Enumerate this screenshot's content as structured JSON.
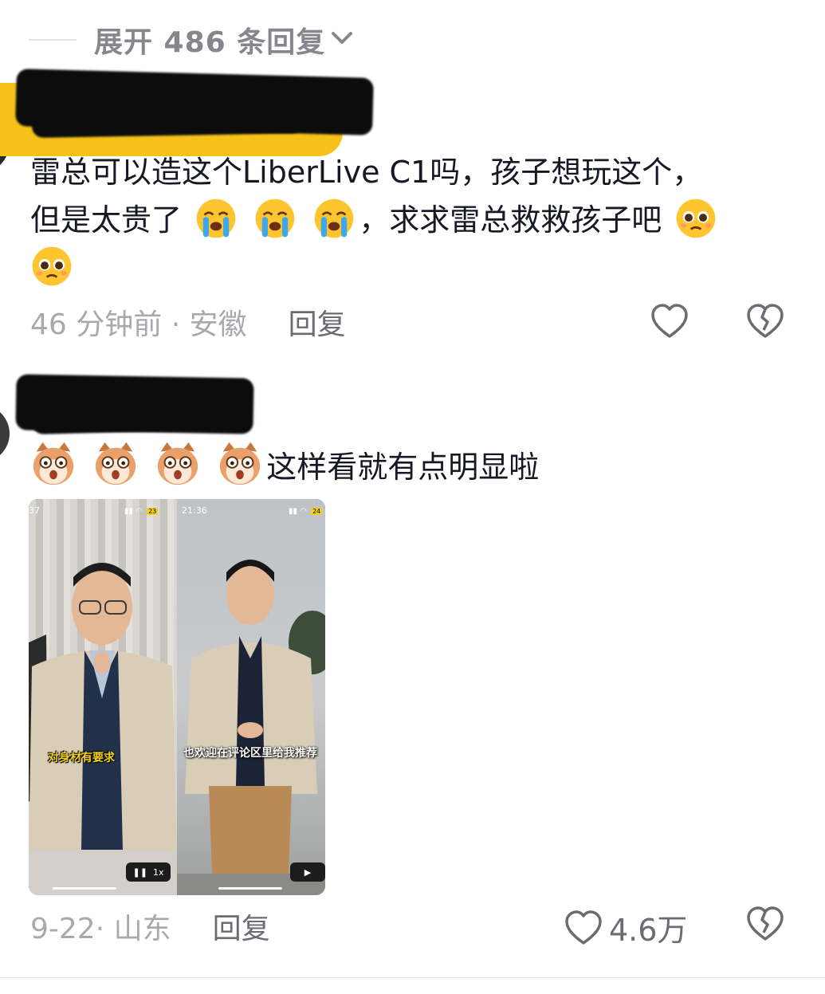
{
  "expand": {
    "label": "展开 486 条回复"
  },
  "comments": [
    {
      "text_line1": "雷总可以造这个LiberLive C1吗，孩子想玩这个，",
      "text_line2a": "但是太贵了",
      "text_line2b": "，求求雷总救救孩子吧",
      "time": "46 分钟前 · 安徽",
      "reply": "回复",
      "like_count": ""
    },
    {
      "text": "这样看就有点明显啦",
      "time": "9-22· 山东",
      "reply": "回复",
      "like_count": "4.6万",
      "video": {
        "left_time": "37",
        "right_time": "21:36",
        "left_battery": "23",
        "right_battery": "24",
        "left_caption": "对身材有要求",
        "right_caption": "也欢迎在评论区里给我推荐",
        "speed": "1x"
      }
    }
  ],
  "icons": [
    "chevron-down-icon",
    "heart-icon",
    "broken-heart-icon",
    "crying-emoji",
    "pleading-emoji",
    "cat-emoji",
    "pause-icon",
    "play-icon"
  ]
}
